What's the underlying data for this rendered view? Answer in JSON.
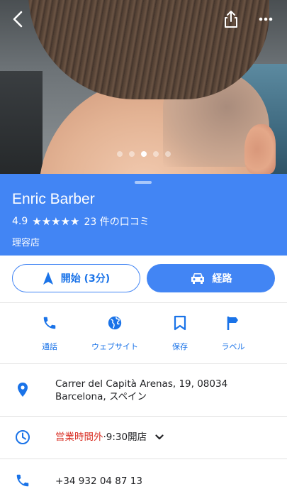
{
  "photo": {
    "back_icon": "chevron-left-icon",
    "share_icon": "share-icon",
    "more_icon": "more-horizontal-icon",
    "page_count": 5,
    "active_page": 3
  },
  "place": {
    "name": "Enric Barber",
    "rating": "4.9",
    "stars": "★★★★★",
    "reviews": "23 件の口コミ",
    "category": "理容店"
  },
  "actions": {
    "start_label": "開始 (3分)",
    "route_label": "経路"
  },
  "quick_actions": [
    {
      "label": "通話",
      "icon": "phone-icon"
    },
    {
      "label": "ウェブサイト",
      "icon": "globe-icon"
    },
    {
      "label": "保存",
      "icon": "bookmark-icon"
    },
    {
      "label": "ラベル",
      "icon": "flag-icon"
    }
  ],
  "info": {
    "address_line1": "Carrer del Capità Arenas, 19, 08034",
    "address_line2": "Barcelona, スペイン",
    "hours_status": "営業時間外",
    "hours_separator": " · ",
    "hours_next": "9:30開店",
    "phone": "+34 932 04 87 13"
  },
  "colors": {
    "accent": "#4285f4",
    "link": "#1a73e8",
    "closed": "#d93025"
  }
}
